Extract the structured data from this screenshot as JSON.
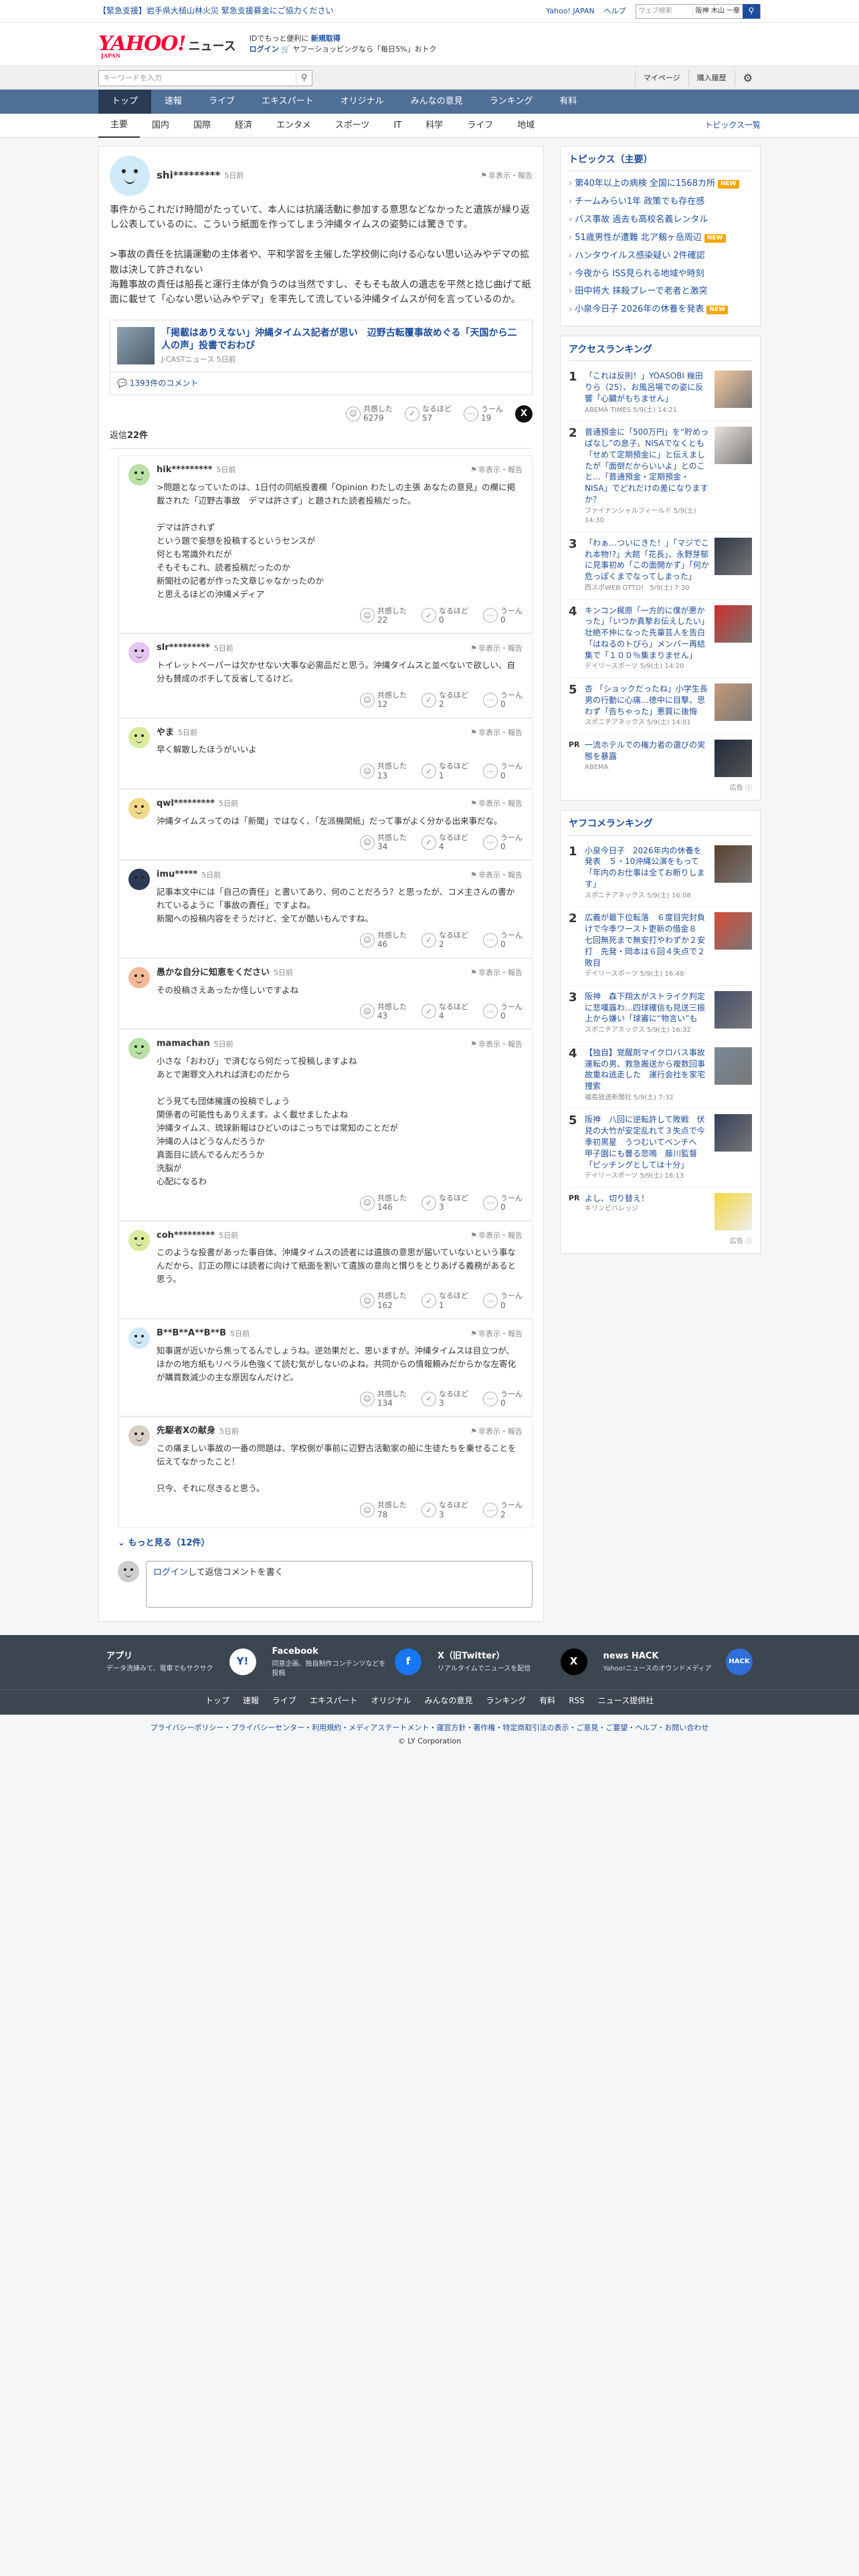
{
  "alert": {
    "text": "【緊急支援】岩手県大槌山林火災 緊急支援募金にご協力ください"
  },
  "top_links": {
    "yahoo_japan": "Yahoo! JAPAN",
    "help": "ヘルプ",
    "search_placeholder": "ウェブ検索",
    "location": "阪神 木山 一章"
  },
  "header": {
    "logo_y": "YAHOO!",
    "logo_news": "ニュース",
    "logo_sub": "JAPAN",
    "promo_line1_a": "IDでもっと便利に",
    "promo_line1_b": "新規取得",
    "promo_line2_a": "ログイン",
    "promo_line2_b": "ヤフーショッピングなら「毎日5%」おトク"
  },
  "search": {
    "placeholder": "キーワードを入力",
    "mypage": "マイページ",
    "history": "購入履歴"
  },
  "main_nav": [
    "トップ",
    "速報",
    "ライブ",
    "エキスパート",
    "オリジナル",
    "みんなの意見",
    "ランキング",
    "有料"
  ],
  "sub_nav": {
    "items": [
      "主要",
      "国内",
      "国際",
      "経済",
      "エンタメ",
      "スポーツ",
      "IT",
      "科学",
      "ライフ",
      "地域"
    ],
    "right": "トピックス一覧"
  },
  "comment": {
    "user": "shi*********",
    "time": "5日前",
    "hide_report": "非表示・報告",
    "body": "事件からこれだけ時間がたっていて、本人には抗議活動に参加する意思などなかったと遺族が繰り返し公表しているのに、こういう紙面を作ってしまう沖縄タイムスの姿勢には驚きです。\n\n>事故の責任を抗議運動の主体者や、平和学習を主催した学校側に向ける心ない思い込みやデマの拡散は決して許されない\n海難事故の責任は船長と運行主体が負うのは当然ですし、そもそも故人の遺志を平然と捻じ曲げて紙面に載せて「心ない思い込みやデマ」を率先して流している沖縄タイムスが何を言っているのか。",
    "article_title": "「掲載はありえない」沖縄タイムス記者が思い　辺野古転覆事故めぐる「天国から二人の声」投書でおわび",
    "article_src": "J-CASTニュース 5日前",
    "article_comments": "1393件のコメント",
    "reactions": {
      "agree_label": "共感した",
      "agree": "6279",
      "hmm_label": "なるほど",
      "hmm": "57",
      "meh_label": "うーん",
      "meh": "19"
    },
    "x_label": "X"
  },
  "reply_count": {
    "prefix": "返信",
    "count": "22件"
  },
  "reactions_labels": {
    "agree": "共感した",
    "hmm": "なるほど",
    "meh": "うーん"
  },
  "replies": [
    {
      "user": "hik*********",
      "time": "5日前",
      "body": ">問題となっていたのは、1日付の同紙投書欄「Opinion わたしの主張 あなたの意見」の欄に掲載された「辺野古事故　デマは許さず」と題された読者投稿だった。\n\nデマは許されず\nという題で妄想を投稿するというセンスが\n何とも常識外れだが\nそもそもこれ、読者投稿だったのか\n新聞社の記者が作った文章じゃなかったのか\nと思えるほどの沖縄メディア",
      "agree": "22",
      "hmm": "0",
      "meh": "0",
      "color": "#b9e0a5"
    },
    {
      "user": "slr*********",
      "time": "5日前",
      "body": "トイレットペーパーは欠かせない大事な必需品だと思う。沖縄タイムスと並べないで欲しい、自分も賛成のボチして反省してるけど。",
      "agree": "12",
      "hmm": "2",
      "meh": "0",
      "color": "#e6c6f0"
    },
    {
      "user": "やま",
      "time": "5日前",
      "body": "早く解散したほうがいいよ",
      "agree": "13",
      "hmm": "1",
      "meh": "0",
      "color": "#d9ec9e"
    },
    {
      "user": "qwl*********",
      "time": "5日前",
      "body": "沖縄タイムスってのは「新聞」ではなく、「左派機関紙」だって事がよく分かる出来事だな。",
      "agree": "34",
      "hmm": "4",
      "meh": "0",
      "color": "#f0d98a"
    },
    {
      "user": "imu*****",
      "time": "5日前",
      "body": "記事本文中には「自己の責任」と書いてあり、何のことだろう？と思ったが、コメ主さんの書かれているように「事故の責任」ですよね。\n新聞への投稿内容をそうだけど、全てが酷いもんですね。",
      "agree": "46",
      "hmm": "2",
      "meh": "0",
      "color": "#2d3a55"
    },
    {
      "user": "愚かな自分に知恵をください",
      "time": "5日前",
      "body": "その投稿さえあったか怪しいですよね",
      "agree": "43",
      "hmm": "4",
      "meh": "0",
      "color": "#f2b99a"
    },
    {
      "user": "mamachan",
      "time": "5日前",
      "body": "小さな「おわび」で済むなら何だって投稿しますよね\nあとで謝罪文入れれば済むのだから\n\nどう見ても団体擁護の投稿でしょう\n関係者の可能性もありえます。よく載せましたよね\n沖縄タイムス、琉球新報はひどいのはこっちでは常知のことだが\n沖縄の人はどうなんだろうか\n真面目に読んでるんだろうか\n洗脳が\n心配になるわ",
      "agree": "146",
      "hmm": "3",
      "meh": "0",
      "color": "#b9e0a5"
    },
    {
      "user": "coh*********",
      "time": "5日前",
      "body": "このような投書があった事自体、沖縄タイムスの読者には遺族の意思が届いていないという事なんだから、訂正の際には読者に向けて紙面を割いて遺族の意向と慣りをとりあげる義務があると思う。",
      "agree": "162",
      "hmm": "1",
      "meh": "0",
      "color": "#d9ec9e"
    },
    {
      "user": "B**B**A**B**B",
      "time": "5日前",
      "body": "知事選が近いから焦ってるんでしょうね。逆効果だと、思いますが。沖縄タイムスは目立つが、ほかの地方紙もリベラル色強くて読む気がしないのよね。共同からの情報頼みだからかな左寄化が購買数減少の主な原因なんだけど。",
      "agree": "134",
      "hmm": "3",
      "meh": "0",
      "color": "#cfe9f7"
    },
    {
      "user": "先駆者Xの献身",
      "time": "5日前",
      "body": "この痛ましい事故の一番の問題は、学校側が事前に辺野古活動家の船に生徒たちを乗せることを伝えてなかったこと！\n\n只今、それに尽きると思う。",
      "agree": "78",
      "hmm": "3",
      "meh": "2",
      "color": "#d8d0c8"
    }
  ],
  "more_replies": {
    "label": "もっと見る",
    "count": "（12件）"
  },
  "reply_form": {
    "login": "ログイン",
    "rest": "して返信コメントを書く"
  },
  "sidebar": {
    "topics_title": "トピックス（主要）",
    "topics": [
      {
        "t": "第40年以上の病検 全国に1568カ所",
        "new": true
      },
      {
        "t": "チームみらい1年 政策でも存在感",
        "new": false
      },
      {
        "t": "バス事故 過去も高校名義レンタル",
        "new": false
      },
      {
        "t": "51歳男性が遭難 北ア剱ヶ岳周辺",
        "new": true
      },
      {
        "t": "ハンタウイルス感染疑い 2件確認",
        "new": false
      },
      {
        "t": "今夜から ISS見られる地域や時刻",
        "new": false
      },
      {
        "t": "田中将大 抹殺プレーで老者と激突",
        "new": false
      },
      {
        "t": "小泉今日子 2026年の休養を発表",
        "new": true
      }
    ],
    "new_label": "NEW",
    "access_title": "アクセスランキング",
    "access": [
      {
        "n": "1",
        "t": "「これは反則！」YOASOBI 幾田りら（25）、お風呂場での姿に反響「心臓がもちません」",
        "m": "ABEMA TIMES 5/9(土) 14:21",
        "c": "#f3c9a0"
      },
      {
        "n": "2",
        "t": "普通預金に「500万円」を“貯めっぱなし”の息子。NISAでなくとも「せめて定期預金に」と伝えましたが「面倒だからいいよ」とのこと…「普通預金・定期預金・NISA」でどれだけの差になりますか？",
        "m": "ファイナンシャルフィールド 5/9(土) 14:30",
        "c": "#e9e2dc"
      },
      {
        "n": "3",
        "t": "「わぁ…ついにきた！」「マジでこれ本物!?」大館「花長」、永野芽郁に見事初め「この面開かず」「何か危っぽくまでなってしまった」",
        "m": "西スポWEB OTTO！ 5/9(土) 7:30",
        "c": "#2e3844"
      },
      {
        "n": "4",
        "t": "キンコン梶原「一方的に僕が悪かった」「いつか真摯お伝えしたい」壮絶不仲になった先輩芸人を告白「はねるのトびら」メンバー再結集で「１００％集まりません」",
        "m": "デイリースポーツ 5/9(土) 14:20",
        "c": "#c9302c"
      },
      {
        "n": "5",
        "t": "杏 「ショックだったね」小学生長男の行動に心痛…徳中に目撃、思わず「告ちゃった」悪質に後悔",
        "m": "スポニチアネックス 5/9(土) 14:01",
        "c": "#c79a7a"
      }
    ],
    "access_pr": {
      "tag": "PR",
      "t": "一流ホテルでの権力者の選びの実態を暴露",
      "m": "ABEMA",
      "c": "#1f2a3a"
    },
    "ad_label": "広告",
    "yafoo_title": "ヤフコメランキング",
    "yafoo": [
      {
        "n": "1",
        "t": "小泉今日子　2026年内の休養を発表　５・10沖縄公演をもって「年内のお仕事は全てお断りします」",
        "m": "スポニチアネックス 5/9(土) 16:08",
        "c": "#5a4030"
      },
      {
        "n": "2",
        "t": "広義が最下位転落　６度目完封負けで今季ワースト更新の借金８　七回無死まで無安打やわずか２安打　先発・岡本は６回４失点で２敗目",
        "m": "デイリースポーツ 5/9(土) 16:48",
        "c": "#d44c3a"
      },
      {
        "n": "3",
        "t": "阪神　森下翔太がストライク判定に悲嘆露わ…四球確信も見送三振　上から嫌い「球審に“物言い”も",
        "m": "スポニチアネックス 5/9(土) 16:32",
        "c": "#45506a"
      },
      {
        "n": "4",
        "t": "【独自】覚醒剤マイクロバス事故運転の男、救急搬送から複数回事故重ね逃走した　運行会社を家宅捜索",
        "m": "福島放送新聞社 5/9(土) 7:32",
        "c": "#7a8a9a"
      },
      {
        "n": "5",
        "t": "阪神　八回に逆転許して敗戦　伏見の大竹が安定乱れて３失点で今季初黒星　うつむいてベンチへ　甲子園にも曇る悲鳴　藤川監督「ピッチングとしては十分」",
        "m": "デイリースポーツ 5/9(土) 16:13",
        "c": "#34405a"
      }
    ],
    "yafoo_pr": {
      "tag": "PR",
      "t": "よし、切り替え！",
      "m": "キリンビバレッジ",
      "c": "#f3d640"
    }
  },
  "footer": {
    "cols": [
      {
        "title": "アプリ",
        "desc": "データ洗練みて、電車でもサクサク",
        "icon": "Y!",
        "bg": "#ffffff",
        "fg": "#1d4d9c"
      },
      {
        "title": "Facebook",
        "desc": "同意企画、独自制作コンテンツなどを投稿",
        "icon": "f",
        "bg": "#1877f2",
        "fg": "#ffffff"
      },
      {
        "title": "X（旧Twitter）",
        "desc": "リアルタイムでニュースを配信",
        "icon": "X",
        "bg": "#000000",
        "fg": "#ffffff"
      },
      {
        "title": "news HACK",
        "desc": "Yahoo!ニュースのオウンドメディア",
        "icon": "HACK",
        "bg": "#2f6fd6",
        "fg": "#ffffff"
      }
    ],
    "links": [
      "トップ",
      "速報",
      "ライブ",
      "エキスパート",
      "オリジナル",
      "みんなの意見",
      "ランキング",
      "有料",
      "RSS",
      "ニュース提供社"
    ],
    "policy": "プライバシーポリシー・プライバシーセンター・利用規約・メディアステートメント・運営方針・著作権・特定商取引法の表示・ご意見・ご要望・ヘルプ・お問い合わせ",
    "copyright": "© LY Corporation"
  }
}
